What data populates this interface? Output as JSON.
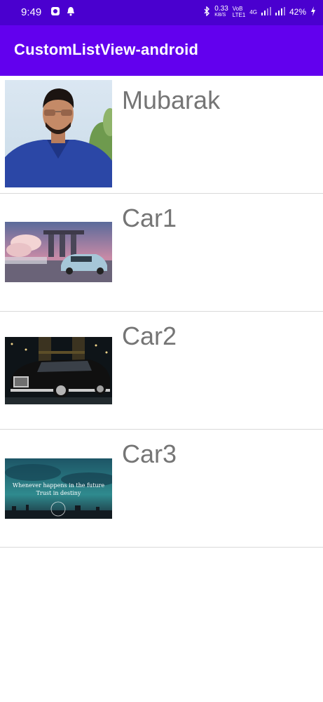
{
  "status_bar": {
    "time": "9:49",
    "network_speed": "0.33",
    "network_speed_unit": "KB/S",
    "volte": "VoB",
    "volte2": "LTE1",
    "signal_label": "4G",
    "battery": "42%",
    "icons": [
      "gear-icon",
      "bell-icon",
      "bluetooth-icon",
      "signal-icon",
      "battery-charging-icon"
    ]
  },
  "app_bar": {
    "title": "CustomListView-android",
    "color": "#6200ee",
    "status_color": "#4a00cf"
  },
  "list": {
    "items": [
      {
        "label": "Mubarak",
        "image": "person-photo"
      },
      {
        "label": "Car1",
        "image": "car-photo-city"
      },
      {
        "label": "Car2",
        "image": "car-photo-night"
      },
      {
        "label": "Car3",
        "image": "sky-quote-image"
      }
    ]
  },
  "quote_image": {
    "line1": "Whenever happens in the future",
    "line2": "Trust in destiny"
  }
}
